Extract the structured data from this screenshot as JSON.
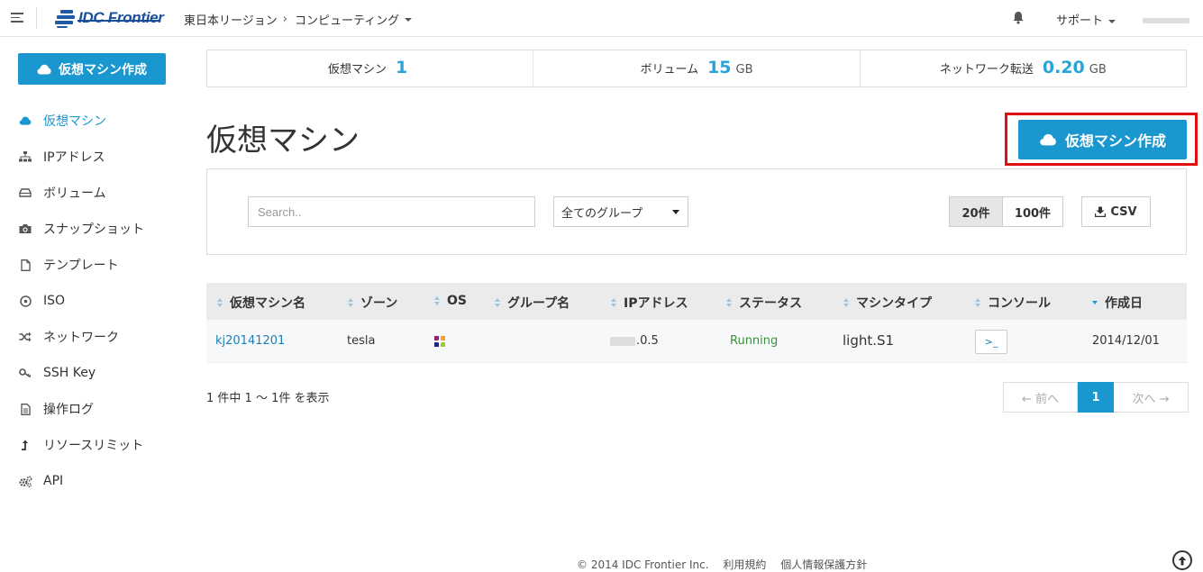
{
  "brand": {
    "logo_text": "IDC Frontier"
  },
  "breadcrumb": {
    "region": "東日本リージョン",
    "separator": "›",
    "section": "コンピューティング"
  },
  "header": {
    "support": "サポート"
  },
  "sidebar": {
    "create_button": "仮想マシン作成",
    "items": [
      {
        "label": "仮想マシン",
        "icon": "cloud-icon",
        "active": true
      },
      {
        "label": "IPアドレス",
        "icon": "sitemap-icon"
      },
      {
        "label": "ボリューム",
        "icon": "hdd-icon"
      },
      {
        "label": "スナップショット",
        "icon": "camera-icon"
      },
      {
        "label": "テンプレート",
        "icon": "file-icon"
      },
      {
        "label": "ISO",
        "icon": "disc-icon"
      },
      {
        "label": "ネットワーク",
        "icon": "shuffle-icon"
      },
      {
        "label": "SSH Key",
        "icon": "key-icon"
      },
      {
        "label": "操作ログ",
        "icon": "document-icon"
      },
      {
        "label": "リソースリミット",
        "icon": "level-up-icon"
      },
      {
        "label": "API",
        "icon": "cogs-icon"
      }
    ]
  },
  "stats": {
    "vm_label": "仮想マシン",
    "vm_count": "1",
    "vol_label": "ボリューム",
    "vol_value": "15",
    "vol_unit": "GB",
    "net_label": "ネットワーク転送",
    "net_value": "0.20",
    "net_unit": "GB"
  },
  "page": {
    "title": "仮想マシン",
    "create_button": "仮想マシン作成"
  },
  "filter": {
    "search_placeholder": "Search..",
    "group_selected": "全てのグループ",
    "per_page_20": "20件",
    "per_page_100": "100件",
    "csv": "CSV"
  },
  "table": {
    "columns": [
      "仮想マシン名",
      "ゾーン",
      "OS",
      "グループ名",
      "IPアドレス",
      "ステータス",
      "マシンタイプ",
      "コンソール",
      "作成日"
    ],
    "rows": [
      {
        "name": "kj20141201",
        "zone": "tesla",
        "group": "",
        "ip_suffix": ".0.5",
        "status": "Running",
        "machine_type": "light.S1",
        "console": ">_",
        "created": "2014/12/01"
      }
    ]
  },
  "pagination": {
    "summary": "1 件中 1 〜 1件 を表示",
    "prev": "← 前へ",
    "current": "1",
    "next": "次へ →"
  },
  "footer": {
    "copyright": "© 2014 IDC Frontier Inc.",
    "terms": "利用規約",
    "privacy": "個人情報保護方針"
  },
  "colors": {
    "accent": "#1a97cf",
    "highlight_border": "#e01010",
    "status_running": "#3c8f3c"
  }
}
